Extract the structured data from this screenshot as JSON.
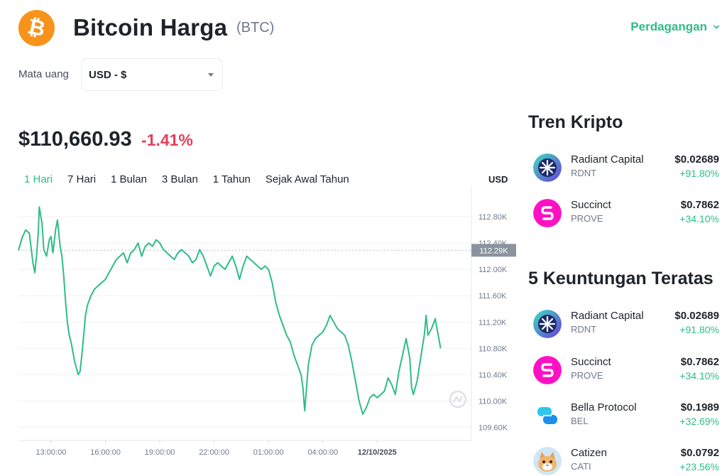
{
  "header": {
    "coin_glyph": "₿",
    "title": "Bitcoin Harga",
    "symbol": "(BTC)",
    "trade_link": "Perdagangan"
  },
  "currency": {
    "label": "Mata uang",
    "selected": "USD - $"
  },
  "price": {
    "value": "$110,660.93",
    "change": "-1.41%"
  },
  "tabs": [
    "1 Hari",
    "7 Hari",
    "1 Bulan",
    "3 Bulan",
    "1 Tahun",
    "Sejak Awal Tahun"
  ],
  "usd_label": "USD",
  "colors": {
    "accent_green": "#2ebd85",
    "negative_red": "#e2405a",
    "bitcoin_orange": "#f7931a",
    "price_tag_grey": "#8b949e"
  },
  "chart_data": {
    "type": "line",
    "ylim": [
      109400,
      113200
    ],
    "y_ticks": [
      {
        "value": 112800,
        "label": "112.80K"
      },
      {
        "value": 112400,
        "label": "112.40K"
      },
      {
        "value": 112000,
        "label": "112.00K"
      },
      {
        "value": 111600,
        "label": "111.60K"
      },
      {
        "value": 111200,
        "label": "111.20K"
      },
      {
        "value": 110800,
        "label": "110.80K"
      },
      {
        "value": 110400,
        "label": "110.40K"
      },
      {
        "value": 110000,
        "label": "110.00K"
      },
      {
        "value": 109600,
        "label": "109.60K"
      }
    ],
    "current_price": {
      "value": 112290,
      "label": "112.29K"
    },
    "x_ticks": [
      "13:00:00",
      "16:00:00",
      "19:00:00",
      "22:00:00",
      "01:00:00",
      "04:00:00",
      "12/10/2025"
    ],
    "x_tick_positions": [
      1,
      4,
      7,
      10,
      13,
      16,
      19
    ],
    "x_range": [
      -0.8,
      24.2
    ],
    "grid": true,
    "series": [
      {
        "points": [
          [
            -0.8,
            112290
          ],
          [
            -0.6,
            112480
          ],
          [
            -0.4,
            112600
          ],
          [
            -0.2,
            112550
          ],
          [
            0.0,
            112100
          ],
          [
            0.1,
            111950
          ],
          [
            0.2,
            112200
          ],
          [
            0.3,
            112600
          ],
          [
            0.35,
            112950
          ],
          [
            0.5,
            112700
          ],
          [
            0.6,
            112300
          ],
          [
            0.75,
            112200
          ],
          [
            0.9,
            112450
          ],
          [
            1.0,
            112500
          ],
          [
            1.1,
            112250
          ],
          [
            1.25,
            112600
          ],
          [
            1.35,
            112750
          ],
          [
            1.5,
            112350
          ],
          [
            1.6,
            112200
          ],
          [
            1.7,
            111900
          ],
          [
            1.8,
            111500
          ],
          [
            1.9,
            111200
          ],
          [
            2.0,
            111000
          ],
          [
            2.1,
            110900
          ],
          [
            2.2,
            110750
          ],
          [
            2.3,
            110600
          ],
          [
            2.4,
            110500
          ],
          [
            2.5,
            110400
          ],
          [
            2.6,
            110450
          ],
          [
            2.7,
            110700
          ],
          [
            2.8,
            111000
          ],
          [
            2.9,
            111300
          ],
          [
            3.0,
            111450
          ],
          [
            3.2,
            111600
          ],
          [
            3.4,
            111700
          ],
          [
            3.6,
            111750
          ],
          [
            3.8,
            111800
          ],
          [
            4.0,
            111850
          ],
          [
            4.2,
            111950
          ],
          [
            4.4,
            112050
          ],
          [
            4.6,
            112150
          ],
          [
            4.8,
            112200
          ],
          [
            5.0,
            112250
          ],
          [
            5.2,
            112100
          ],
          [
            5.4,
            112250
          ],
          [
            5.6,
            112300
          ],
          [
            5.8,
            112400
          ],
          [
            6.0,
            112200
          ],
          [
            6.2,
            112350
          ],
          [
            6.4,
            112400
          ],
          [
            6.6,
            112350
          ],
          [
            6.8,
            112450
          ],
          [
            7.0,
            112400
          ],
          [
            7.2,
            112300
          ],
          [
            7.4,
            112250
          ],
          [
            7.6,
            112200
          ],
          [
            7.8,
            112150
          ],
          [
            8.0,
            112250
          ],
          [
            8.2,
            112300
          ],
          [
            8.4,
            112250
          ],
          [
            8.6,
            112200
          ],
          [
            8.8,
            112100
          ],
          [
            9.0,
            112150
          ],
          [
            9.2,
            112300
          ],
          [
            9.4,
            112200
          ],
          [
            9.6,
            112050
          ],
          [
            9.8,
            111900
          ],
          [
            10.0,
            112050
          ],
          [
            10.2,
            112100
          ],
          [
            10.4,
            112050
          ],
          [
            10.6,
            112000
          ],
          [
            10.8,
            112100
          ],
          [
            11.0,
            112200
          ],
          [
            11.2,
            112050
          ],
          [
            11.4,
            111850
          ],
          [
            11.6,
            112050
          ],
          [
            11.8,
            112200
          ],
          [
            12.0,
            112150
          ],
          [
            12.2,
            112100
          ],
          [
            12.4,
            112050
          ],
          [
            12.6,
            112000
          ],
          [
            12.8,
            112050
          ],
          [
            13.0,
            112000
          ],
          [
            13.2,
            111800
          ],
          [
            13.4,
            111500
          ],
          [
            13.6,
            111300
          ],
          [
            13.8,
            111150
          ],
          [
            14.0,
            111000
          ],
          [
            14.2,
            110900
          ],
          [
            14.4,
            110700
          ],
          [
            14.6,
            110550
          ],
          [
            14.8,
            110400
          ],
          [
            14.9,
            110200
          ],
          [
            15.0,
            109850
          ],
          [
            15.1,
            110200
          ],
          [
            15.2,
            110550
          ],
          [
            15.4,
            110850
          ],
          [
            15.6,
            110950
          ],
          [
            15.8,
            111000
          ],
          [
            16.0,
            111050
          ],
          [
            16.2,
            111150
          ],
          [
            16.4,
            111300
          ],
          [
            16.6,
            111200
          ],
          [
            16.8,
            111100
          ],
          [
            17.0,
            111050
          ],
          [
            17.2,
            111000
          ],
          [
            17.4,
            110850
          ],
          [
            17.6,
            110600
          ],
          [
            17.8,
            110300
          ],
          [
            18.0,
            110000
          ],
          [
            18.2,
            109800
          ],
          [
            18.4,
            109900
          ],
          [
            18.6,
            110050
          ],
          [
            18.8,
            110100
          ],
          [
            19.0,
            110050
          ],
          [
            19.2,
            110100
          ],
          [
            19.4,
            110150
          ],
          [
            19.6,
            110350
          ],
          [
            19.8,
            110250
          ],
          [
            20.0,
            110100
          ],
          [
            20.2,
            110450
          ],
          [
            20.4,
            110700
          ],
          [
            20.6,
            110950
          ],
          [
            20.8,
            110650
          ],
          [
            20.9,
            110200
          ],
          [
            21.0,
            110100
          ],
          [
            21.2,
            110300
          ],
          [
            21.4,
            110650
          ],
          [
            21.6,
            111000
          ],
          [
            21.7,
            111300
          ],
          [
            21.8,
            111000
          ],
          [
            22.0,
            111100
          ],
          [
            22.2,
            111250
          ],
          [
            22.4,
            110950
          ],
          [
            22.5,
            110800
          ]
        ]
      }
    ]
  },
  "trending": {
    "title": "Tren Kripto",
    "items": [
      {
        "name": "Radiant Capital",
        "symbol": "RDNT",
        "price": "$0.02689",
        "change": "+91.80%",
        "icon": "radiant-capital-icon"
      },
      {
        "name": "Succinct",
        "symbol": "PROVE",
        "price": "$0.7862",
        "change": "+34.10%",
        "icon": "succinct-icon"
      }
    ]
  },
  "top_gainers": {
    "title": "5 Keuntungan Teratas",
    "items": [
      {
        "name": "Radiant Capital",
        "symbol": "RDNT",
        "price": "$0.02689",
        "change": "+91.80%",
        "icon": "radiant-capital-icon"
      },
      {
        "name": "Succinct",
        "symbol": "PROVE",
        "price": "$0.7862",
        "change": "+34.10%",
        "icon": "succinct-icon"
      },
      {
        "name": "Bella Protocol",
        "symbol": "BEL",
        "price": "$0.1989",
        "change": "+32.69%",
        "icon": "bella-protocol-icon"
      },
      {
        "name": "Catizen",
        "symbol": "CATI",
        "price": "$0.0792",
        "change": "+23.56%",
        "icon": "catizen-icon"
      }
    ]
  }
}
